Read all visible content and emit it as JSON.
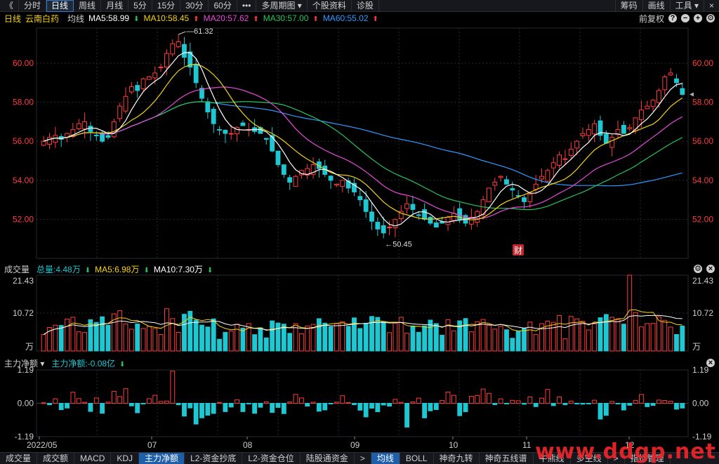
{
  "toolbar": {
    "back": "《",
    "tabs": [
      "分时",
      "日线",
      "周线",
      "月线",
      "5分",
      "15分",
      "30分",
      "60分",
      "•••",
      "多周期图 ▾",
      "个股资料",
      "诊股"
    ],
    "active_tab": "日线",
    "right": [
      "筹码",
      "画线",
      "工具 ▾"
    ]
  },
  "info": {
    "period": "日线",
    "stock_name": "云南白药",
    "line_type": "均线",
    "ma5": "MA5:58.99",
    "ma10": "MA10:58.45",
    "ma20": "MA20:57.62",
    "ma30": "MA30:57.00",
    "ma60": "MA60:55.02",
    "adjust": "前复权",
    "colors": {
      "ma5": "#ffffff",
      "ma10": "#f5d40f",
      "ma20": "#e84ad6",
      "ma30": "#27c45a",
      "ma60": "#2f9bff",
      "up": "#ff3b3b",
      "down": "#1ec8d2"
    }
  },
  "volume_panel": {
    "title": "成交量",
    "total": "总量:4.48万",
    "ma5": "MA5:6.98万",
    "ma10": "MA10:7.30万",
    "y_ticks": [
      "21.43",
      "10.72",
      "万"
    ]
  },
  "flow_panel": {
    "title": "主力净额 ▾",
    "value": "主力净额:-0.08亿",
    "y_ticks": [
      "1.19",
      "0.00",
      "-1.19"
    ]
  },
  "price_axis": [
    "60.00",
    "58.00",
    "56.00",
    "54.00",
    "52.00"
  ],
  "annotations": {
    "high": "61.32",
    "low": "50.45",
    "finance_badge": "财"
  },
  "x_axis": [
    "2022/05",
    "07",
    "08",
    "09",
    "10",
    "11",
    "12"
  ],
  "bottom_tabs": [
    "成交量",
    "成交额",
    "MACD",
    "KDJ",
    "主力净额",
    "L2-资金抄底",
    "L2-资金仓位",
    "陆股通资金",
    ">",
    "均线",
    "BOLL",
    "神奇九转",
    "神奇五线谱",
    "牛熊线",
    "多空线",
    ">",
    "指标管理"
  ],
  "watermark": "www.ddgp.net",
  "chart_data": {
    "type": "candlestick",
    "y_range": [
      50.0,
      61.8
    ],
    "close_path": [
      56.0,
      56.2,
      56.3,
      56.1,
      56.4,
      56.6,
      56.9,
      57.0,
      56.5,
      56.3,
      56.0,
      56.2,
      57.0,
      57.8,
      58.3,
      58.8,
      58.6,
      59.2,
      59.3,
      59.5,
      59.8,
      60.5,
      61.0,
      61.1,
      60.3,
      59.8,
      59.0,
      58.2,
      57.5,
      56.9,
      56.6,
      56.4,
      56.4,
      56.7,
      56.8,
      56.6,
      56.5,
      56.4,
      56.1,
      55.5,
      54.8,
      54.3,
      53.9,
      54.2,
      54.5,
      54.6,
      54.8,
      54.6,
      54.3,
      54.0,
      53.8,
      54.0,
      53.6,
      53.4,
      53.0,
      52.4,
      51.9,
      51.5,
      51.3,
      51.6,
      52.0,
      52.4,
      52.8,
      52.5,
      52.2,
      52.0,
      51.8,
      51.6,
      51.8,
      52.1,
      52.3,
      52.0,
      51.8,
      52.1,
      52.4,
      53.0,
      53.6,
      53.9,
      54.2,
      53.8,
      53.5,
      53.2,
      52.9,
      53.3,
      53.8,
      54.2,
      54.5,
      54.9,
      55.3,
      55.1,
      55.6,
      56.0,
      56.4,
      56.6,
      56.9,
      56.3,
      55.9,
      56.2,
      56.6,
      56.4,
      56.7,
      57.2,
      57.6,
      57.8,
      58.1,
      58.6,
      59.3,
      59.5,
      59.0,
      58.4
    ],
    "high_marker": 61.32,
    "low_marker": 50.45,
    "volume_max": 21.43,
    "volume_unit": "万",
    "net_flow_range": [
      -1.19,
      1.19
    ],
    "net_flow_unit": "亿"
  }
}
